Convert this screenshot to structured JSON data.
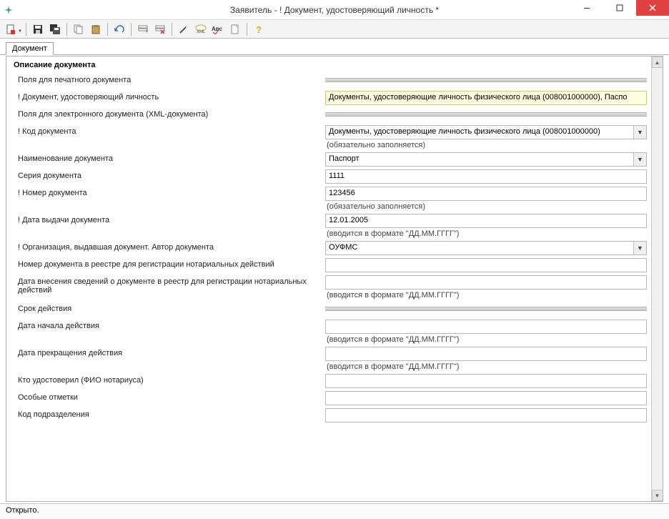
{
  "window": {
    "title": "Заявитель - ! Документ, удостоверяющий личность *"
  },
  "toolbar_icons": {
    "new": "new-doc-icon",
    "save": "save-icon",
    "saveall": "saveall-icon",
    "copy": "copy-icon",
    "paste": "paste-icon",
    "undo": "undo-icon",
    "addrow": "addrow-icon",
    "delrow": "delrow-icon",
    "wand": "wand-icon",
    "xml": "xml-icon",
    "spell": "abc-icon",
    "page": "page-icon",
    "help": "help-icon"
  },
  "tab": {
    "label": "Документ"
  },
  "group_title": "Описание документа",
  "labels": {
    "print_fields": "Поля для печатного документа",
    "identity_doc": "! Документ, удостоверяющий личность",
    "xml_fields": "Поля для электронного документа (XML-документа)",
    "doc_code": "! Код документа",
    "doc_name": "Наименование документа",
    "doc_series": "Серия документа",
    "doc_number": "! Номер документа",
    "issue_date": "! Дата выдачи документа",
    "issuer_org": "! Организация, выдавшая документ. Автор документа",
    "registry_number": "Номер документа в реестре для регистрации нотариальных действий",
    "registry_date": "Дата внесения сведений о документе в реестр для регистрации нотариальных действий",
    "validity": "Срок действия",
    "start_date": "Дата начала действия",
    "end_date": "Дата прекращения действия",
    "certified_by": "Кто удостоверил (ФИО нотариуса)",
    "special_marks": "Особые отметки",
    "dept_code": "Код подразделения"
  },
  "hints": {
    "required": "(обязательно заполняется)",
    "date_fmt": "(вводится в формате \"ДД.ММ.ГГГГ\")"
  },
  "values": {
    "identity_doc": "Документы, удостоверяющие личность физического лица (008001000000), Паспо",
    "doc_code": "Документы, удостоверяющие личность физического лица (008001000000)",
    "doc_name": "Паспорт",
    "doc_series": "1111",
    "doc_number": "123456",
    "issue_date": "12.01.2005",
    "issuer_org": "ОУФМС",
    "registry_number": "",
    "registry_date": "",
    "start_date": "",
    "end_date": "",
    "certified_by": "",
    "special_marks": "",
    "dept_code": ""
  },
  "status": "Открыто."
}
